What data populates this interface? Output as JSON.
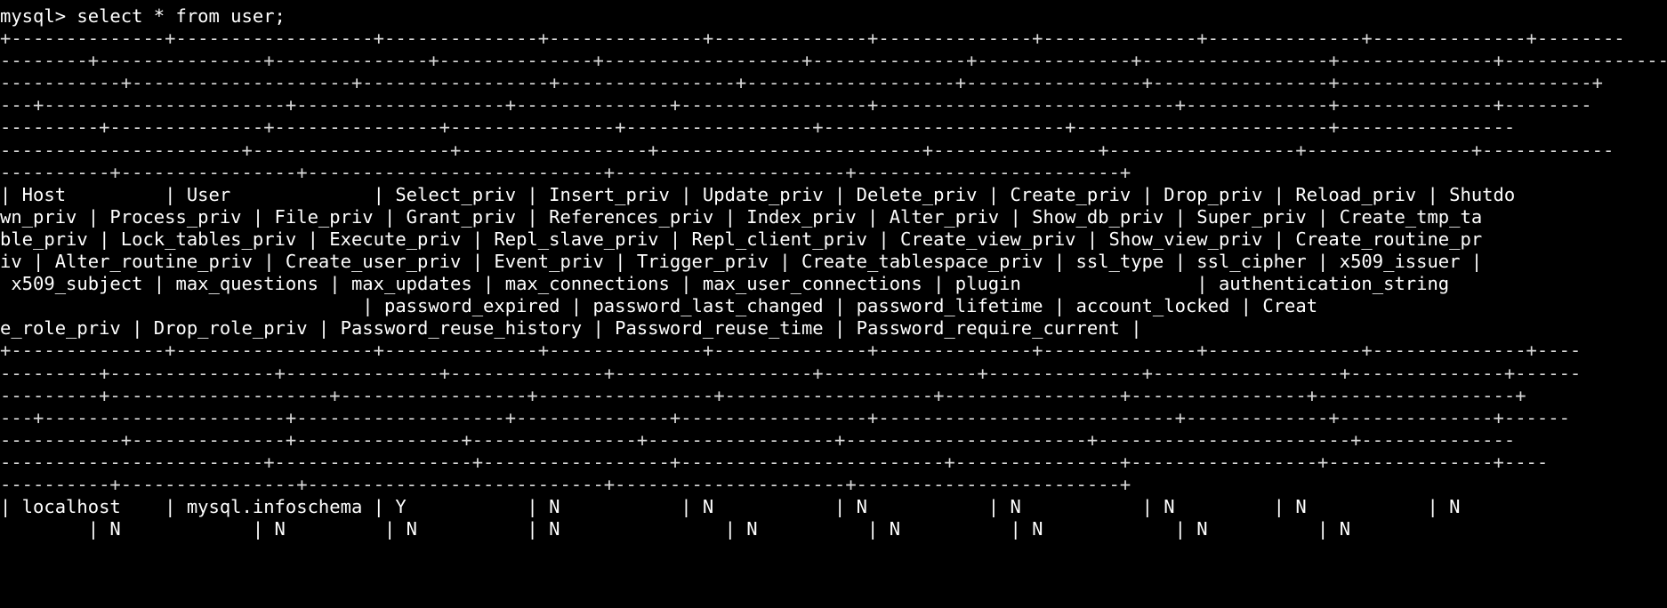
{
  "terminal": {
    "app": "mysql-client-terminal",
    "background_color": "#000000",
    "foreground_color": "#e6e6e6",
    "prompt": "mysql>",
    "command": "select * from user;",
    "prompt_line": "mysql> select * from user;",
    "lines": [
      {
        "name": "prompt-line",
        "kind": "prompt",
        "text": "mysql> select * from user;"
      },
      {
        "name": "separator-line-1",
        "kind": "rule",
        "text": "+--------------+------------------+--------------+--------------+--------------+--------------+--------------+--------------+--------------+--------"
      },
      {
        "name": "separator-line-2",
        "kind": "rule",
        "text": "--------+---------------+--------------+--------------+------------------+--------------+--------------+-----------------+--------------+----------------"
      },
      {
        "name": "separator-line-3",
        "kind": "rule",
        "text": "-----------+--------------------+-----------------+----------------+-------------------+----------------+----------------+-----------------------+"
      },
      {
        "name": "separator-line-4",
        "kind": "rule",
        "text": "---+----------------------+-------------------+--------------+-----------------+---------------------------+-------------+--------------+--------"
      },
      {
        "name": "separator-line-5",
        "kind": "rule",
        "text": "---------+--------------+---------------+---------------+-----------------+----------------------+-----------------------+----------------"
      },
      {
        "name": "separator-line-6",
        "kind": "rule",
        "text": "----------------------+------------------+-----------------+------------------------+---------------+-----------------+---------------+------------"
      },
      {
        "name": "separator-line-7",
        "kind": "rule",
        "text": "----------+----------------+---------------------------+---------------------+------------------------+"
      },
      {
        "name": "header-line-1",
        "kind": "header",
        "text": "| Host         | User             | Select_priv | Insert_priv | Update_priv | Delete_priv | Create_priv | Drop_priv | Reload_priv | Shutdo"
      },
      {
        "name": "header-line-2",
        "kind": "header",
        "text": "wn_priv | Process_priv | File_priv | Grant_priv | References_priv | Index_priv | Alter_priv | Show_db_priv | Super_priv | Create_tmp_ta"
      },
      {
        "name": "header-line-3",
        "kind": "header",
        "text": "ble_priv | Lock_tables_priv | Execute_priv | Repl_slave_priv | Repl_client_priv | Create_view_priv | Show_view_priv | Create_routine_pr"
      },
      {
        "name": "header-line-4",
        "kind": "header",
        "text": "iv | Alter_routine_priv | Create_user_priv | Event_priv | Trigger_priv | Create_tablespace_priv | ssl_type | ssl_cipher | x509_issuer |"
      },
      {
        "name": "header-line-5",
        "kind": "header",
        "text": " x509_subject | max_questions | max_updates | max_connections | max_user_connections | plugin                | authentication_string"
      },
      {
        "name": "header-line-6",
        "kind": "header",
        "text": "                                 | password_expired | password_last_changed | password_lifetime | account_locked | Creat"
      },
      {
        "name": "header-line-7",
        "kind": "header",
        "text": "e_role_priv | Drop_role_priv | Password_reuse_history | Password_reuse_time | Password_require_current |"
      },
      {
        "name": "separator-line-8",
        "kind": "rule",
        "text": "+--------------+------------------+--------------+--------------+--------------+--------------+--------------+--------------+--------------+----"
      },
      {
        "name": "separator-line-9",
        "kind": "rule",
        "text": "---------+---------------+--------------+--------------+------------------+--------------+--------------+-----------------+--------------+------"
      },
      {
        "name": "separator-line-10",
        "kind": "rule",
        "text": "---------+--------------------+-----------------+----------------+-------------------+----------------+----------------+------------------+"
      },
      {
        "name": "separator-line-11",
        "kind": "rule",
        "text": "---+----------------------+-------------------+--------------+-----------------+---------------------------+-------------+--------------+------"
      },
      {
        "name": "separator-line-12",
        "kind": "rule",
        "text": "-----------+--------------+---------------+---------------+-----------------+----------------------+-----------------------+--------------"
      },
      {
        "name": "separator-line-13",
        "kind": "rule",
        "text": "------------------------+------------------+-----------------+------------------------+---------------+-----------------+---------------+----"
      },
      {
        "name": "separator-line-14",
        "kind": "rule",
        "text": "----------+----------------+---------------------------+---------------------+------------------------+"
      },
      {
        "name": "data-row-1",
        "kind": "data",
        "text": "| localhost    | mysql.infoschema | Y           | N           | N           | N           | N           | N         | N           | N"
      },
      {
        "name": "data-row-1-continued",
        "kind": "data",
        "text": "        | N            | N         | N          | N               | N          | N          | N            | N          | N"
      }
    ],
    "query_result": {
      "table": "user",
      "columns": [
        "Host",
        "User",
        "Select_priv",
        "Insert_priv",
        "Update_priv",
        "Delete_priv",
        "Create_priv",
        "Drop_priv",
        "Reload_priv",
        "Shutdown_priv",
        "Process_priv",
        "File_priv",
        "Grant_priv",
        "References_priv",
        "Index_priv",
        "Alter_priv",
        "Show_db_priv",
        "Super_priv",
        "Create_tmp_table_priv",
        "Lock_tables_priv",
        "Execute_priv",
        "Repl_slave_priv",
        "Repl_client_priv",
        "Create_view_priv",
        "Show_view_priv",
        "Create_routine_priv",
        "Alter_routine_priv",
        "Create_user_priv",
        "Event_priv",
        "Trigger_priv",
        "Create_tablespace_priv",
        "ssl_type",
        "ssl_cipher",
        "x509_issuer",
        "x509_subject",
        "max_questions",
        "max_updates",
        "max_connections",
        "max_user_connections",
        "plugin",
        "authentication_string",
        "password_expired",
        "password_last_changed",
        "password_lifetime",
        "account_locked",
        "Create_role_priv",
        "Drop_role_priv",
        "Password_reuse_history",
        "Password_reuse_time",
        "Password_require_current"
      ],
      "first_row_visible": {
        "Host": "localhost",
        "User": "mysql.infoschema",
        "Select_priv": "Y",
        "Insert_priv": "N",
        "Update_priv": "N",
        "Delete_priv": "N",
        "Create_priv": "N",
        "Drop_priv": "N",
        "Reload_priv": "N",
        "Shutdown_priv": "N"
      }
    }
  }
}
